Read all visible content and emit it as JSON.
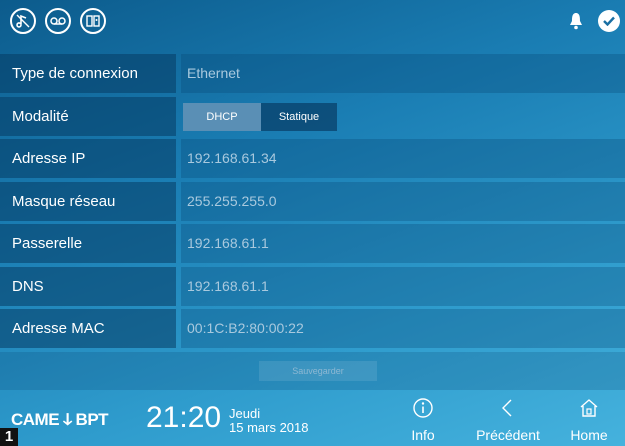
{
  "topbar": {
    "icons": [
      "music-icon",
      "voicemail-icon",
      "intercom-icon"
    ],
    "status_icons": [
      "bell-icon",
      "check-icon"
    ]
  },
  "form": {
    "rows": [
      {
        "label": "Type de connexion",
        "value": "Ethernet"
      },
      {
        "label": "Modalité",
        "options": [
          "DHCP",
          "Statique"
        ],
        "selected": "DHCP"
      },
      {
        "label": "Adresse IP",
        "value": "192.168.61.34"
      },
      {
        "label": "Masque réseau",
        "value": "255.255.255.0"
      },
      {
        "label": "Passerelle",
        "value": "192.168.61.1"
      },
      {
        "label": "DNS",
        "value": "192.168.61.1"
      },
      {
        "label": "Adresse MAC",
        "value": "00:1C:B2:80:00:22"
      }
    ],
    "save_label": "Sauvegarder"
  },
  "footer": {
    "brand_left": "CAME",
    "brand_sep": "Ꚍ",
    "brand_right": "BPT",
    "time": "21:20",
    "day": "Jeudi",
    "date": "15 mars 2018",
    "nav": [
      {
        "label": "Info",
        "icon": "info-icon"
      },
      {
        "label": "Précédent",
        "icon": "chevron-left-icon"
      },
      {
        "label": "Home",
        "icon": "home-icon"
      }
    ]
  },
  "marker": "1"
}
